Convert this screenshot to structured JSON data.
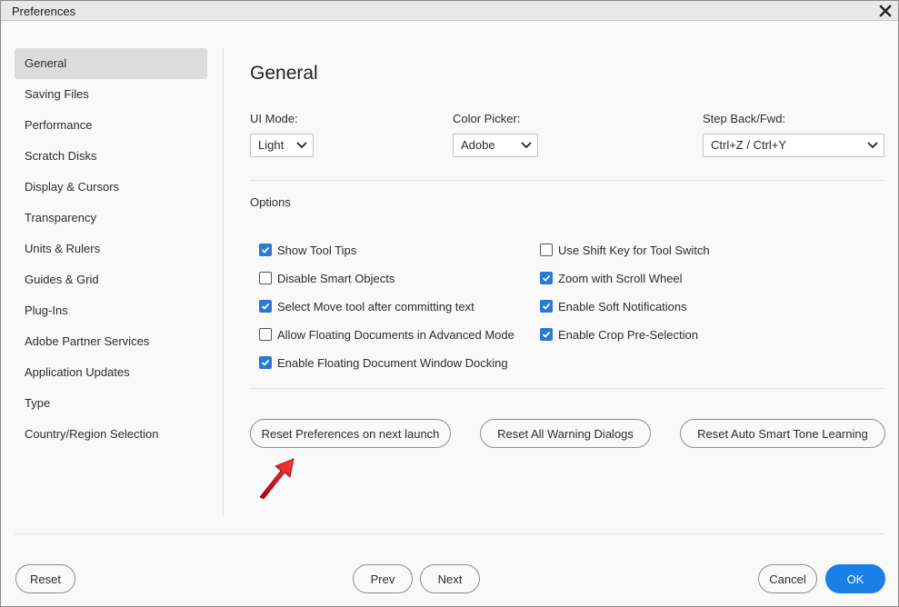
{
  "window": {
    "title": "Preferences"
  },
  "sidebar": {
    "items": [
      {
        "label": "General",
        "active": true
      },
      {
        "label": "Saving Files"
      },
      {
        "label": "Performance"
      },
      {
        "label": "Scratch Disks"
      },
      {
        "label": "Display & Cursors"
      },
      {
        "label": "Transparency"
      },
      {
        "label": "Units & Rulers"
      },
      {
        "label": "Guides & Grid"
      },
      {
        "label": "Plug-Ins"
      },
      {
        "label": "Adobe Partner Services"
      },
      {
        "label": "Application Updates"
      },
      {
        "label": "Type"
      },
      {
        "label": "Country/Region Selection"
      }
    ]
  },
  "main": {
    "title": "General",
    "ui_mode": {
      "label": "UI Mode:",
      "value": "Light"
    },
    "color_picker": {
      "label": "Color Picker:",
      "value": "Adobe"
    },
    "step_back": {
      "label": "Step Back/Fwd:",
      "value": "Ctrl+Z / Ctrl+Y"
    },
    "options_label": "Options",
    "options": [
      {
        "label": "Show Tool Tips",
        "checked": true
      },
      {
        "label": "Disable Smart Objects",
        "checked": false
      },
      {
        "label": "Select Move tool after committing text",
        "checked": true
      },
      {
        "label": "Allow Floating Documents in Advanced Mode",
        "checked": false
      },
      {
        "label": "Enable Floating Document Window Docking",
        "checked": true
      },
      {
        "label": "Use Shift Key for Tool Switch",
        "checked": false
      },
      {
        "label": "Zoom with Scroll Wheel",
        "checked": true
      },
      {
        "label": "Enable Soft Notifications",
        "checked": true
      },
      {
        "label": "Enable Crop Pre-Selection",
        "checked": true
      }
    ],
    "reset_prefs_label": "Reset Preferences on next launch",
    "reset_warnings_label": "Reset All Warning Dialogs",
    "reset_smart_tone_label": "Reset Auto Smart Tone Learning"
  },
  "footer": {
    "reset_label": "Reset",
    "prev_label": "Prev",
    "next_label": "Next",
    "cancel_label": "Cancel",
    "ok_label": "OK"
  },
  "colors": {
    "accent": "#1a80e6",
    "checkbox": "#2b78d6",
    "annotation_arrow": "#e0141e"
  }
}
